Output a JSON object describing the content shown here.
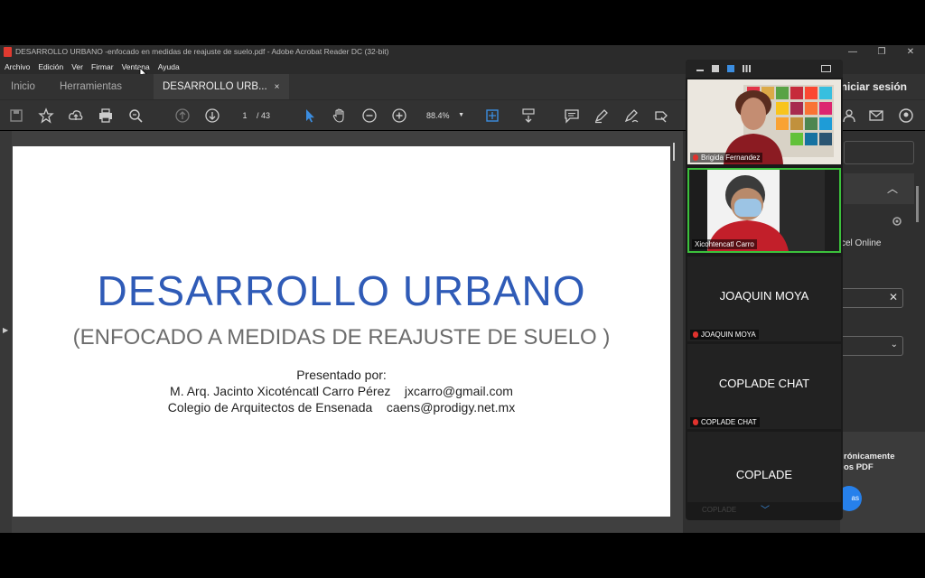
{
  "app": {
    "window_title": "DESARROLLO URBANO -enfocado en medidas de reajuste de suelo.pdf - Adobe Acrobat Reader DC (32-bit)",
    "window_controls": [
      "—",
      "❐",
      "✕"
    ]
  },
  "menubar": {
    "items": [
      "Archivo",
      "Edición",
      "Ver",
      "Firmar",
      "Ventana",
      "Ayuda"
    ]
  },
  "tabs": {
    "home": "Inicio",
    "tools": "Herramientas",
    "document": "DESARROLLO URB...",
    "close": "×",
    "sign_in": "Iniciar sesión"
  },
  "toolbar": {
    "page_current": "1",
    "page_total": "/ 43",
    "zoom": "88.4%"
  },
  "slide": {
    "title": "DESARROLLO URBANO",
    "subtitle": "(ENFOCADO A MEDIDAS DE REAJUSTE DE SUELO )",
    "presented_by": "Presentado por:",
    "author_line": "M. Arq. Jacinto Xicoténcatl Carro Pérez    jxcarro@gmail.com",
    "org_line": "Colegio de Arquitectos de Ensenada    caens@prodigy.net.mx"
  },
  "right_panel": {
    "excel_text": "cel Online",
    "bottom_text_1": "rónicamente",
    "bottom_text_2": "os PDF",
    "button": "as"
  },
  "participants": [
    {
      "name": "Brigida Fernandez",
      "video": true
    },
    {
      "name": "Xicohtencatl Carro",
      "video": true,
      "active_speaker": true
    },
    {
      "name": "JOAQUIN MOYA",
      "display": "JOAQUIN MOYA",
      "video": false
    },
    {
      "name": "COPLADE CHAT",
      "display": "COPLADE CHAT",
      "video": false
    },
    {
      "name": "COPLADE",
      "display": "COPLADE",
      "video": false
    }
  ],
  "colors": {
    "slide_title": "#2f5bb7",
    "active_border": "#3cc13c",
    "accent": "#2680eb"
  }
}
